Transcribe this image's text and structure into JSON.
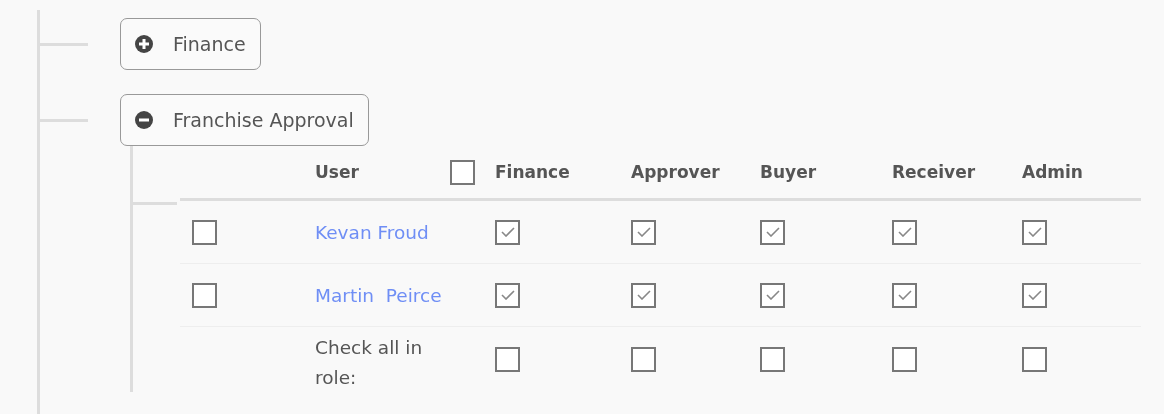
{
  "groups": [
    {
      "label": "Finance",
      "expanded": false
    },
    {
      "label": "Franchise Approval",
      "expanded": true,
      "table": {
        "user_heading": "User",
        "select_all_checked": false,
        "roles": [
          "Finance",
          "Approver",
          "Buyer",
          "Receiver",
          "Admin"
        ],
        "rows": [
          {
            "checked": false,
            "user": "Kevan Froud",
            "roles": [
              true,
              true,
              true,
              true,
              true
            ]
          },
          {
            "checked": false,
            "user": "Martin  Peirce",
            "roles": [
              true,
              true,
              true,
              true,
              true
            ]
          }
        ],
        "footer": {
          "label": "Check all in role:",
          "roles": [
            false,
            false,
            false,
            false,
            false
          ]
        }
      }
    }
  ]
}
